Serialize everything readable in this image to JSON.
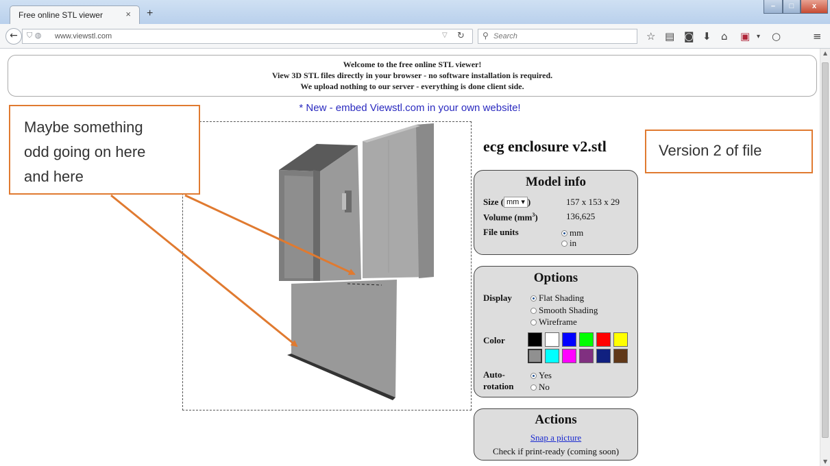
{
  "browser": {
    "tab_title": "Free online STL viewer",
    "tab_close": "×",
    "new_tab": "+",
    "url": "www.viewstl.com",
    "search_placeholder": "Search",
    "window_controls": {
      "minimize": "–",
      "maximize": "□",
      "close": "x"
    }
  },
  "welcome": {
    "line1": "Welcome to the free online STL viewer!",
    "line2": "View 3D STL files directly in your browser - no software installation is required.",
    "line3": "We upload nothing to our server - everything is done client side."
  },
  "embed_link": "* New - embed Viewstl.com in your own website!",
  "file_title": "ecg enclosure v2.stl",
  "model_info": {
    "title": "Model info",
    "size_label": "Size (",
    "size_unit": "mm",
    "size_close": ")",
    "size_value": "157 x 153 x 29",
    "volume_label": "Volume (mm",
    "volume_sup": "3",
    "volume_close": ")",
    "volume_value": "136,625",
    "file_units_label": "File units",
    "units": [
      {
        "label": "mm",
        "selected": true
      },
      {
        "label": "in",
        "selected": false
      }
    ]
  },
  "options": {
    "title": "Options",
    "display_label": "Display",
    "display_modes": [
      {
        "label": "Flat Shading",
        "selected": true
      },
      {
        "label": "Smooth Shading",
        "selected": false
      },
      {
        "label": "Wireframe",
        "selected": false
      }
    ],
    "color_label": "Color",
    "colors": [
      "#000000",
      "#ffffff",
      "#0000ff",
      "#00ff00",
      "#ff0000",
      "#ffff00",
      "#909090",
      "#00ffff",
      "#ff00ff",
      "#803080",
      "#102080",
      "#603818"
    ],
    "selected_color": "#909090",
    "autorotation_label_1": "Auto-",
    "autorotation_label_2": "rotation",
    "autorotation": [
      {
        "label": "Yes",
        "selected": true
      },
      {
        "label": "No",
        "selected": false
      }
    ]
  },
  "actions": {
    "title": "Actions",
    "snap": "Snap a picture",
    "check": "Check if print-ready (coming soon)"
  },
  "annotations": {
    "left_line1": "Maybe something",
    "left_line2": "odd going on here",
    "left_line3": "and here",
    "right": "Version 2 of file",
    "accent": "#e07a30"
  }
}
